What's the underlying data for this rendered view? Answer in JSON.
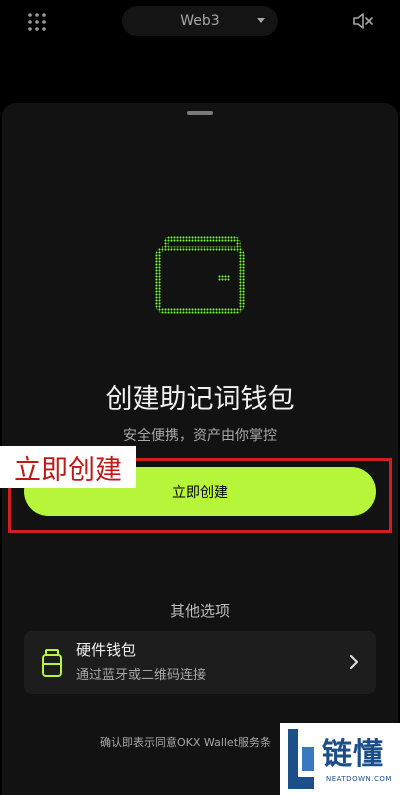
{
  "topbar": {
    "network_label": "Web3",
    "icons": {
      "menu": "grid-icon",
      "network_toggle": "caret-down-icon",
      "sound": "mute-icon"
    }
  },
  "sheet": {
    "title": "创建助记词钱包",
    "subtitle": "安全便携，资产由你掌控",
    "create_button_label": "立即创建",
    "other_options_label": "其他选项",
    "hardware_wallet": {
      "title": "硬件钱包",
      "subtitle": "通过蓝牙或二维码连接"
    },
    "terms_text": "确认即表示同意OKX Wallet服务条"
  },
  "annotation": {
    "text": "立即创建",
    "color": "#c01717"
  },
  "watermark": {
    "title": "链懂",
    "subtitle": "NEATDOWN.COM"
  },
  "colors": {
    "accent": "#b7f53a",
    "icon_green": "#7cf53a",
    "highlight_border": "#d11f1f",
    "sheet_bg": "#121212"
  }
}
